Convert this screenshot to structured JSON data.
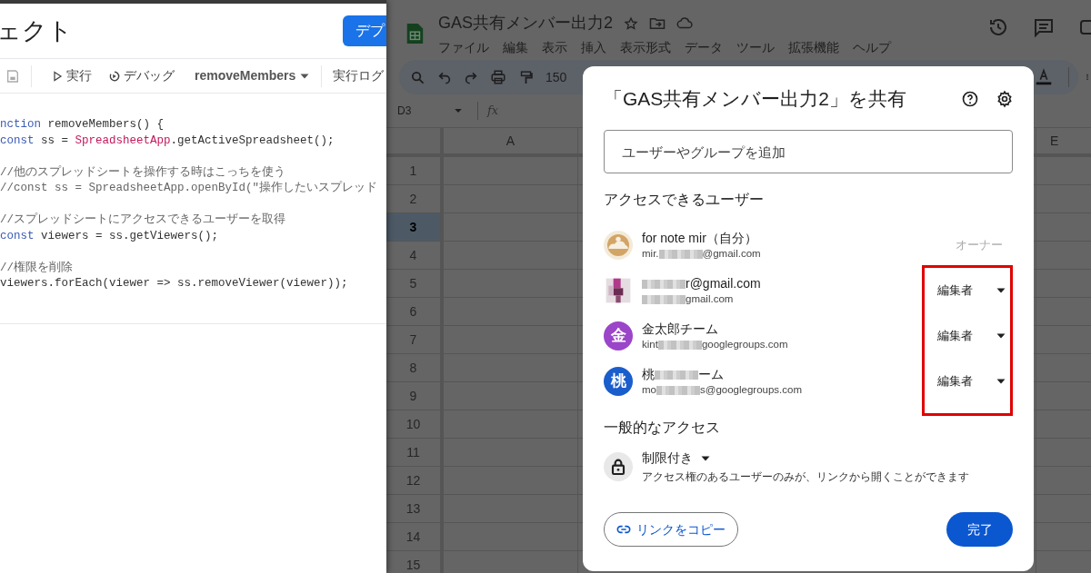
{
  "editor": {
    "title": "ェクト",
    "deploy_button": "デプ",
    "toolbar": {
      "run": "実行",
      "debug": "デバッグ",
      "function": "removeMembers",
      "log": "実行ログ"
    },
    "code_lines": [
      {
        "blank_before": false,
        "tokens": [
          {
            "kind": "kw",
            "text": "nction"
          },
          {
            "kind": "plain",
            "text": " removeMembers() {"
          }
        ]
      },
      {
        "blank_before": false,
        "tokens": [
          {
            "kind": "kw",
            "text": "const"
          },
          {
            "kind": "plain",
            "text": " ss = "
          },
          {
            "kind": "cls",
            "text": "SpreadsheetApp"
          },
          {
            "kind": "plain",
            "text": ".getActiveSpreadsheet();"
          }
        ]
      },
      {
        "blank_before": true,
        "tokens": [
          {
            "kind": "comment",
            "text": "//他のスプレッドシートを操作する時はこっちを使う"
          }
        ]
      },
      {
        "blank_before": false,
        "tokens": [
          {
            "kind": "comment",
            "text": "//const ss = SpreadsheetApp.openById(\"操作したいスプレッド"
          }
        ]
      },
      {
        "blank_before": true,
        "tokens": [
          {
            "kind": "comment",
            "text": "//スプレッドシートにアクセスできるユーザーを取得"
          }
        ]
      },
      {
        "blank_before": false,
        "tokens": [
          {
            "kind": "kw",
            "text": "const"
          },
          {
            "kind": "plain",
            "text": " viewers = ss.getViewers();"
          }
        ]
      },
      {
        "blank_before": true,
        "tokens": [
          {
            "kind": "comment",
            "text": "//権限を削除"
          }
        ]
      },
      {
        "blank_before": false,
        "tokens": [
          {
            "kind": "plain",
            "text": "viewers.forEach(viewer => ss.removeViewer(viewer));"
          }
        ]
      }
    ]
  },
  "sheet": {
    "title": "GAS共有メンバー出力2",
    "menu": [
      "ファイル",
      "編集",
      "表示",
      "挿入",
      "表示形式",
      "データ",
      "ツール",
      "拡張機能",
      "ヘルプ"
    ],
    "zoom": "150",
    "name_box": "D3",
    "formula_icon": "fx",
    "columns": [
      "A",
      "E"
    ],
    "rows": [
      {
        "label": "1",
        "selected": false
      },
      {
        "label": "2",
        "selected": false
      },
      {
        "label": "3",
        "selected": true
      },
      {
        "label": "4",
        "selected": false
      },
      {
        "label": "5",
        "selected": false
      },
      {
        "label": "6",
        "selected": false
      },
      {
        "label": "7",
        "selected": false
      },
      {
        "label": "8",
        "selected": false
      },
      {
        "label": "9",
        "selected": false
      },
      {
        "label": "10",
        "selected": false
      },
      {
        "label": "11",
        "selected": false
      },
      {
        "label": "12",
        "selected": false
      },
      {
        "label": "13",
        "selected": false
      },
      {
        "label": "14",
        "selected": false
      },
      {
        "label": "15",
        "selected": false
      }
    ]
  },
  "share_dialog": {
    "title": "「GAS共有メンバー出力2」を共有",
    "add_field": {
      "placeholder": "ユーザーやグループを追加"
    },
    "people_heading": "アクセスできるユーザー",
    "roles_highlighted": true,
    "people": [
      {
        "avatar": {
          "kind": "picture"
        },
        "name": [
          {
            "kind": "text",
            "text": "for note mir（自分）"
          }
        ],
        "email": [
          {
            "kind": "text",
            "text": "mir."
          },
          {
            "kind": "redacted"
          },
          {
            "kind": "text",
            "text": "@gmail.com"
          }
        ],
        "role": "オーナー",
        "disabled": true
      },
      {
        "avatar": {
          "kind": "mosaic"
        },
        "name": [
          {
            "kind": "redacted"
          },
          {
            "kind": "text",
            "text": "r@gmail.com"
          }
        ],
        "email": [
          {
            "kind": "redacted"
          },
          {
            "kind": "text",
            "text": "gmail.com"
          }
        ],
        "role": "編集者",
        "disabled": false
      },
      {
        "avatar": {
          "kind": "letter",
          "letter": "金",
          "color": "#9b45c9"
        },
        "name": [
          {
            "kind": "text",
            "text": "金太郎チーム"
          }
        ],
        "email": [
          {
            "kind": "text",
            "text": "kint"
          },
          {
            "kind": "redacted"
          },
          {
            "kind": "text",
            "text": "googlegroups.com"
          }
        ],
        "role": "編集者",
        "disabled": false
      },
      {
        "avatar": {
          "kind": "letter",
          "letter": "桃",
          "color": "#1a5dcc"
        },
        "name": [
          {
            "kind": "text",
            "text": "桃"
          },
          {
            "kind": "redacted"
          },
          {
            "kind": "text",
            "text": "ーム"
          }
        ],
        "email": [
          {
            "kind": "text",
            "text": "mo"
          },
          {
            "kind": "redacted"
          },
          {
            "kind": "text",
            "text": "s@googlegroups.com"
          }
        ],
        "role": "編集者",
        "disabled": false
      }
    ],
    "general_heading": "一般的なアクセス",
    "access": {
      "label": "制限付き",
      "description": "アクセス権のあるユーザーのみが、リンクから開くことができます"
    },
    "copy_link": "リンクをコピー",
    "done": "完了"
  }
}
